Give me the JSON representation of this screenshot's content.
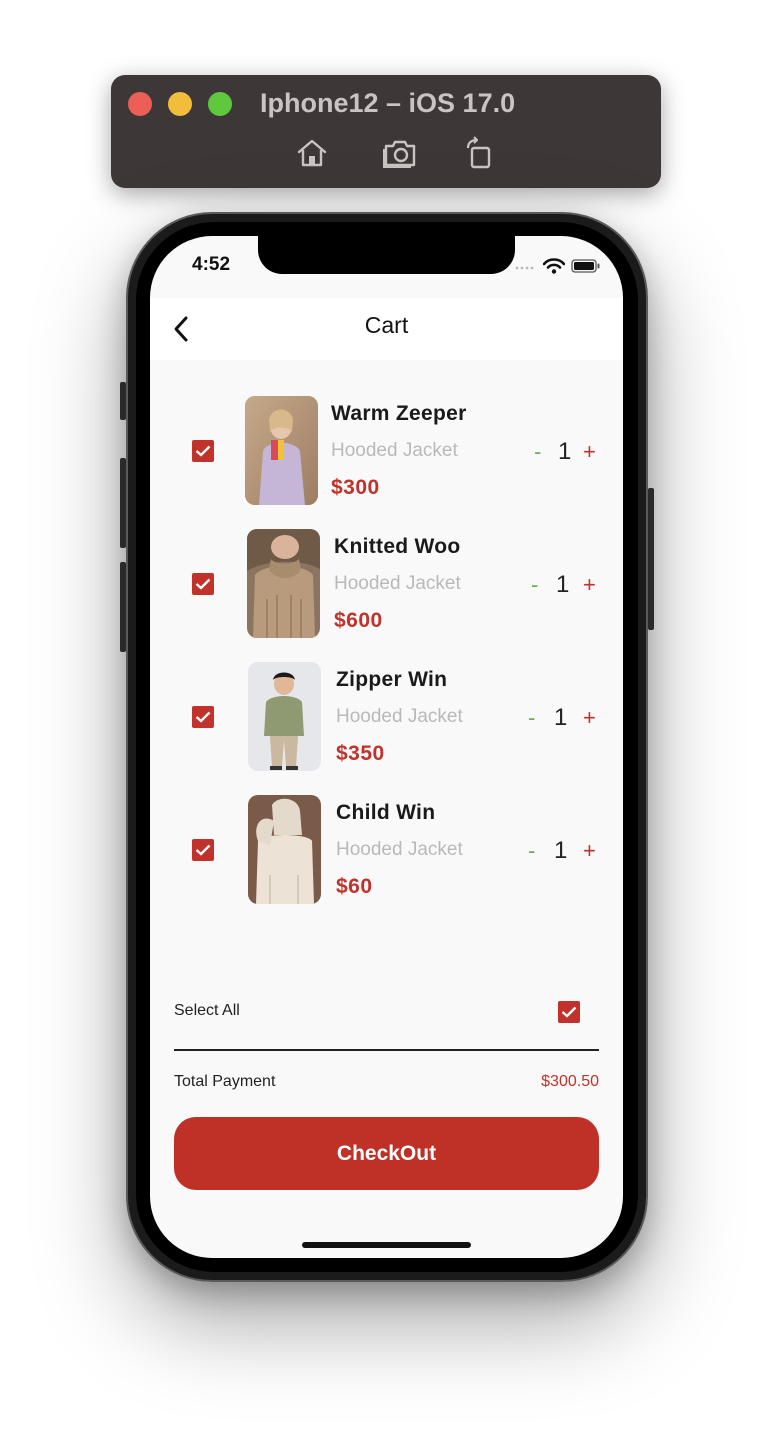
{
  "simulator": {
    "title": "Iphone12 – iOS 17.0",
    "icons": [
      "home-icon",
      "screenshot-icon",
      "rotate-icon"
    ]
  },
  "status_bar": {
    "time": "4:52"
  },
  "header": {
    "title": "Cart"
  },
  "cart_items": [
    {
      "name": "Warm Zeeper",
      "subtitle": "Hooded Jacket",
      "price": "$300",
      "quantity": "1",
      "minus": "-",
      "plus": "+",
      "checked": true
    },
    {
      "name": "Knitted Woo",
      "subtitle": "Hooded Jacket",
      "price": "$600",
      "quantity": "1",
      "minus": "-",
      "plus": "+",
      "checked": true
    },
    {
      "name": "Zipper Win",
      "subtitle": "Hooded Jacket",
      "price": "$350",
      "quantity": "1",
      "minus": "-",
      "plus": "+",
      "checked": true
    },
    {
      "name": "Child Win",
      "subtitle": "Hooded Jacket",
      "price": "$60",
      "quantity": "1",
      "minus": "-",
      "plus": "+",
      "checked": true
    }
  ],
  "footer": {
    "select_all_label": "Select All",
    "select_all_checked": true,
    "total_label": "Total Payment",
    "total_value": "$300.50",
    "checkout_label": "CheckOut"
  },
  "colors": {
    "accent": "#c0322a",
    "minus_green": "#6ab04c",
    "subtitle_gray": "#b9b9b9",
    "screen_bg": "#f9f9f9"
  }
}
